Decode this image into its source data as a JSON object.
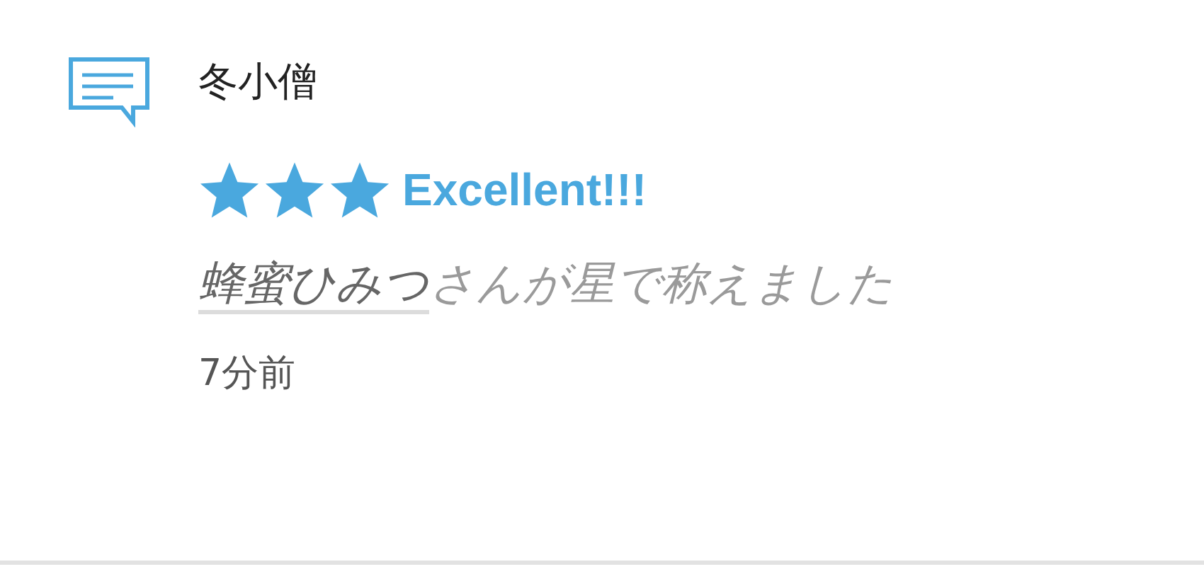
{
  "notification": {
    "username": "冬小僧",
    "stars": 3,
    "rating_label": "Excellent!!!",
    "actor": "蜂蜜ひみつ",
    "message": "さんが星で称えました",
    "time": "7分前"
  }
}
